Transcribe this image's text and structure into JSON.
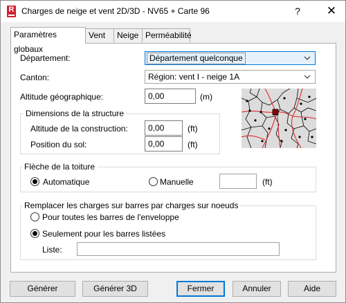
{
  "window": {
    "title": "Charges de neige et vent 2D/3D - NV65 + Carte 96",
    "help": "?",
    "close": "✕"
  },
  "tabs": [
    "Paramètres globaux",
    "Vent",
    "Neige",
    "Perméabilité"
  ],
  "departement": {
    "label": "Département:",
    "value": "Département quelconque"
  },
  "canton": {
    "label": "Canton:",
    "value": "Région: vent I - neige 1A"
  },
  "altitude_geo": {
    "label": "Altitude géographique:",
    "value": "0,00",
    "unit": "(m)"
  },
  "dimensions": {
    "title": "Dimensions de la structure",
    "construction": {
      "label": "Altitude de la construction:",
      "value": "0,00",
      "unit": "(ft)"
    },
    "sol": {
      "label": "Position du sol:",
      "value": "0,00",
      "unit": "(ft)"
    }
  },
  "fleche": {
    "title": "Flèche de la toiture",
    "auto": "Automatique",
    "manuelle": "Manuelle",
    "value": "",
    "unit": "(ft)"
  },
  "remplacer": {
    "title": "Remplacer les charges sur barres par charges sur noeuds",
    "option1": "Pour toutes les barres de l'enveloppe",
    "option2": "Seulement pour les barres listées",
    "liste_label": "Liste:",
    "liste_value": ""
  },
  "buttons": {
    "generer": "Générer",
    "generer3d": "Générer 3D",
    "fermer": "Fermer",
    "annuler": "Annuler",
    "aide": "Aide"
  },
  "colors": {
    "accent": "#0078d7",
    "app_icon": "#d4202f",
    "map_roads": "#e0282c"
  }
}
